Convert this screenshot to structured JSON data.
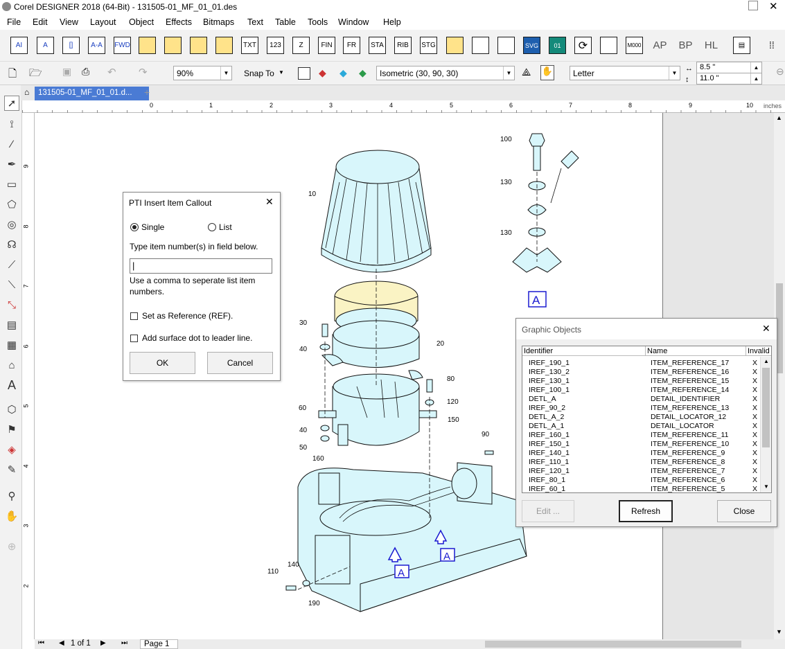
{
  "window": {
    "title": "Corel DESIGNER 2018 (64-Bit) - 131505-01_MF_01_01.des"
  },
  "menu": [
    "File",
    "Edit",
    "View",
    "Layout",
    "Object",
    "Effects",
    "Bitmaps",
    "Text",
    "Table",
    "Tools",
    "Window",
    "Help"
  ],
  "toolbar1": [
    "AI",
    "A",
    "[]",
    "A-A",
    "FWD",
    "",
    "",
    "",
    "",
    "TXT",
    "123",
    "Z",
    "FIN",
    "FR",
    "STA",
    "RIB",
    "STG",
    "",
    "",
    "",
    "SVG",
    "01",
    "",
    "",
    "M000",
    "AP",
    "BP",
    "HL"
  ],
  "toolbar2": {
    "zoom": "90%",
    "snap_label": "Snap To",
    "projection": "Isometric (30, 90, 30)",
    "paper": "Letter",
    "width": "8.5 \"",
    "height": "11.0 \""
  },
  "doc_tab": "131505-01_MF_01_01.d...",
  "ruler": {
    "units": "inches",
    "h_ticks": [
      "0",
      "1",
      "2",
      "3",
      "4",
      "5",
      "6",
      "7",
      "8",
      "9",
      "10"
    ],
    "v_ticks": [
      "9",
      "8",
      "7",
      "6",
      "5",
      "4",
      "3",
      "2"
    ]
  },
  "drawing": {
    "callouts": [
      "10",
      "20",
      "30",
      "40",
      "60",
      "40",
      "50",
      "160",
      "80",
      "120",
      "150",
      "90",
      "110",
      "140",
      "190",
      "100",
      "130",
      "130"
    ],
    "detail_label": "A"
  },
  "callout_dialog": {
    "title": "PTI Insert Item Callout",
    "single_label": "Single",
    "list_label": "List",
    "instruction": "Type item number(s) in field below.",
    "input_value": "",
    "hint": "Use a comma to seperate list item numbers.",
    "ref_label": "Set as Reference (REF).",
    "dot_label": "Add surface dot to leader line.",
    "ok_label": "OK",
    "cancel_label": "Cancel"
  },
  "objects_dialog": {
    "title": "Graphic Objects",
    "headers": [
      "Identifier",
      "Name",
      "Invalid"
    ],
    "rows": [
      [
        "IREF_190_1",
        "ITEM_REFERENCE_17",
        "X"
      ],
      [
        "IREF_130_2",
        "ITEM_REFERENCE_16",
        "X"
      ],
      [
        "IREF_130_1",
        "ITEM_REFERENCE_15",
        "X"
      ],
      [
        "IREF_100_1",
        "ITEM_REFERENCE_14",
        "X"
      ],
      [
        "DETL_A",
        "DETAIL_IDENTIFIER",
        "X"
      ],
      [
        "IREF_90_2",
        "ITEM_REFERENCE_13",
        "X"
      ],
      [
        "DETL_A_2",
        "DETAIL_LOCATOR_12",
        "X"
      ],
      [
        "DETL_A_1",
        "DETAIL_LOCATOR",
        "X"
      ],
      [
        "IREF_160_1",
        "ITEM_REFERENCE_11",
        "X"
      ],
      [
        "IREF_150_1",
        "ITEM_REFERENCE_10",
        "X"
      ],
      [
        "IREF_140_1",
        "ITEM_REFERENCE_9",
        "X"
      ],
      [
        "IREF_110_1",
        "ITEM_REFERENCE_8",
        "X"
      ],
      [
        "IREF_120_1",
        "ITEM_REFERENCE_7",
        "X"
      ],
      [
        "IREF_80_1",
        "ITEM_REFERENCE_6",
        "X"
      ],
      [
        "IREF_60_1",
        "ITEM_REFERENCE_5",
        "X"
      ]
    ],
    "edit_label": "Edit ...",
    "refresh_label": "Refresh",
    "close_label": "Close"
  },
  "status": {
    "page_of": "1 of 1",
    "page_tab": "Page 1"
  },
  "colors": {
    "part_fill": "#d8f6fb",
    "band_fill": "#faf3c4",
    "callout_blue": "#1a1ad0"
  }
}
